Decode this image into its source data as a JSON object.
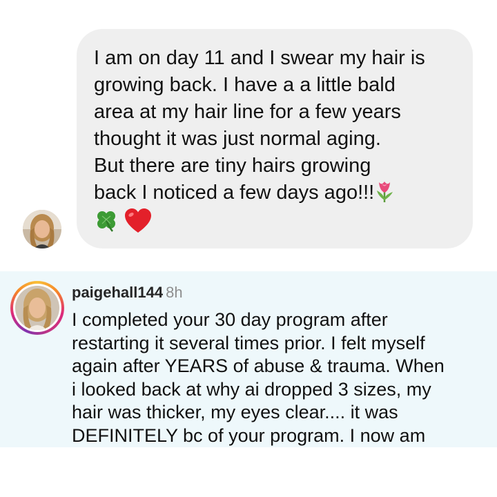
{
  "dm": {
    "message_lines": "I am on day 11 and I swear my hair is\ngrowing back. I have a a little bald\narea at my hair line for a few years\nthought it was just normal aging.\nBut there are tiny hairs growing\nback I noticed a few days ago!!!",
    "inline_emoji": "tulip-icon",
    "trailing_emojis": [
      "four-leaf-clover-icon",
      "red-heart-icon"
    ],
    "bubble_color": "#efefef",
    "avatar": "user-avatar"
  },
  "comment": {
    "username": "paigehall144",
    "time": "8h",
    "body_lines": "I completed your 30 day program after\nrestarting it several times prior. I felt myself\nagain after YEARS of abuse & trauma. When\ni looked back at why ai dropped 3 sizes, my\nhair was thicker, my eyes clear.... it was\nDEFINITELY bc of your program. I now am",
    "background_color": "#eef8fb",
    "avatar": "story-ring-avatar"
  }
}
